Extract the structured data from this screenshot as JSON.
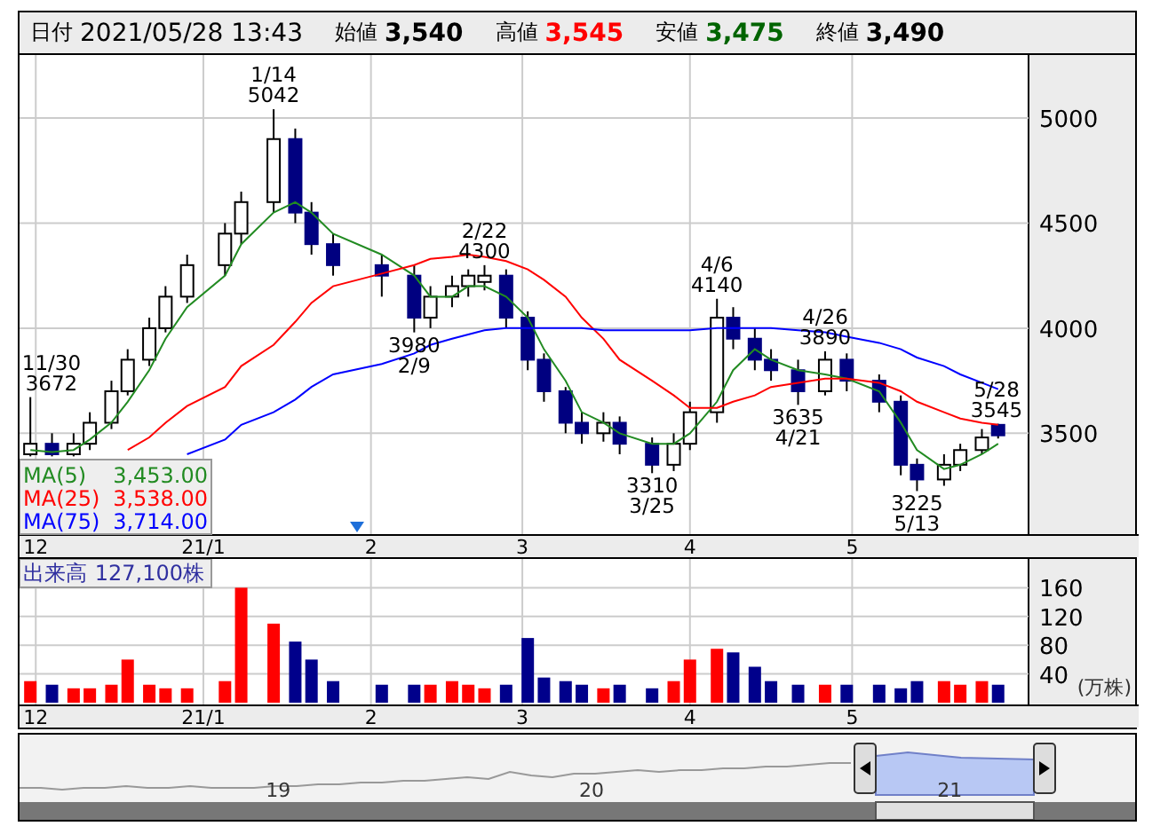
{
  "header": {
    "fields": [
      {
        "label": "日付",
        "value": "2021/05/28 13:43",
        "kind": "date",
        "color": "#000000"
      },
      {
        "label": "始値",
        "value": "3,540",
        "kind": "price",
        "color": "#000000"
      },
      {
        "label": "高値",
        "value": "3,545",
        "kind": "price",
        "color": "#ff0000"
      },
      {
        "label": "安値",
        "value": "3,475",
        "kind": "price",
        "color": "#006400"
      },
      {
        "label": "終値",
        "value": "3,490",
        "kind": "price",
        "color": "#000000"
      }
    ]
  },
  "price_chart": {
    "legend_values": [
      "3,453.00",
      "3,538.00",
      "3,714.00"
    ],
    "chart_data": {
      "type": "candlestick",
      "grid": true,
      "xlim": [
        "2020-11-28",
        "2021-06-23"
      ],
      "ylim": [
        3020,
        5300
      ],
      "yticks": [
        3500,
        4000,
        4500,
        5000
      ],
      "xticks": [
        {
          "value": "2020-12-01",
          "label": "12"
        },
        {
          "value": "2021-01-01",
          "label": "21/1"
        },
        {
          "value": "2021-02-01",
          "label": "2"
        },
        {
          "value": "2021-03-01",
          "label": "3"
        },
        {
          "value": "2021-04-01",
          "label": "4"
        },
        {
          "value": "2021-05-01",
          "label": "5"
        }
      ],
      "x": [
        "2020-11-30",
        "2020-12-04",
        "2020-12-08",
        "2020-12-11",
        "2020-12-15",
        "2020-12-18",
        "2020-12-22",
        "2020-12-25",
        "2020-12-29",
        "2021-01-05",
        "2021-01-08",
        "2021-01-14",
        "2021-01-18",
        "2021-01-21",
        "2021-01-25",
        "2021-02-03",
        "2021-02-09",
        "2021-02-12",
        "2021-02-16",
        "2021-02-19",
        "2021-02-22",
        "2021-02-26",
        "2021-03-02",
        "2021-03-05",
        "2021-03-09",
        "2021-03-12",
        "2021-03-16",
        "2021-03-19",
        "2021-03-25",
        "2021-03-29",
        "2021-04-01",
        "2021-04-06",
        "2021-04-09",
        "2021-04-13",
        "2021-04-16",
        "2021-04-21",
        "2021-04-26",
        "2021-04-30",
        "2021-05-06",
        "2021-05-10",
        "2021-05-13",
        "2021-05-18",
        "2021-05-21",
        "2021-05-25",
        "2021-05-28"
      ],
      "ohlc": [
        [
          3400,
          3672,
          3390,
          3450
        ],
        [
          3450,
          3500,
          3390,
          3400
        ],
        [
          3400,
          3500,
          3390,
          3450
        ],
        [
          3450,
          3600,
          3420,
          3550
        ],
        [
          3550,
          3750,
          3520,
          3700
        ],
        [
          3700,
          3900,
          3680,
          3850
        ],
        [
          3850,
          4050,
          3820,
          4000
        ],
        [
          4000,
          4200,
          3980,
          4150
        ],
        [
          4150,
          4350,
          4120,
          4300
        ],
        [
          4300,
          4500,
          4250,
          4450
        ],
        [
          4450,
          4650,
          4400,
          4600
        ],
        [
          4600,
          5042,
          4550,
          4900
        ],
        [
          4900,
          4950,
          4500,
          4550
        ],
        [
          4550,
          4600,
          4350,
          4400
        ],
        [
          4400,
          4450,
          4250,
          4300
        ],
        [
          4300,
          4350,
          4150,
          4250
        ],
        [
          4250,
          4300,
          3980,
          4050
        ],
        [
          4050,
          4200,
          4000,
          4150
        ],
        [
          4150,
          4250,
          4100,
          4200
        ],
        [
          4200,
          4280,
          4150,
          4250
        ],
        [
          4220,
          4300,
          4180,
          4250
        ],
        [
          4250,
          4280,
          4000,
          4050
        ],
        [
          4050,
          4080,
          3800,
          3850
        ],
        [
          3850,
          3880,
          3650,
          3700
        ],
        [
          3700,
          3720,
          3500,
          3550
        ],
        [
          3550,
          3600,
          3450,
          3500
        ],
        [
          3500,
          3600,
          3460,
          3550
        ],
        [
          3550,
          3580,
          3400,
          3450
        ],
        [
          3450,
          3480,
          3310,
          3350
        ],
        [
          3350,
          3500,
          3320,
          3450
        ],
        [
          3450,
          3650,
          3420,
          3600
        ],
        [
          3600,
          4140,
          3550,
          4050
        ],
        [
          4050,
          4100,
          3900,
          3950
        ],
        [
          3950,
          4000,
          3800,
          3850
        ],
        [
          3850,
          3900,
          3750,
          3800
        ],
        [
          3800,
          3850,
          3635,
          3700
        ],
        [
          3700,
          3890,
          3680,
          3850
        ],
        [
          3850,
          3880,
          3700,
          3750
        ],
        [
          3750,
          3780,
          3600,
          3650
        ],
        [
          3650,
          3680,
          3300,
          3350
        ],
        [
          3350,
          3380,
          3225,
          3280
        ],
        [
          3280,
          3400,
          3250,
          3350
        ],
        [
          3350,
          3450,
          3320,
          3420
        ],
        [
          3420,
          3520,
          3400,
          3480
        ],
        [
          3540,
          3545,
          3475,
          3490
        ]
      ],
      "series": [
        {
          "name": "MA(5)",
          "type": "line",
          "color": "#228b22",
          "values": [
            3420,
            3410,
            3420,
            3470,
            3550,
            3650,
            3800,
            3950,
            4100,
            4250,
            4400,
            4550,
            4600,
            4550,
            4450,
            4350,
            4250,
            4150,
            4150,
            4200,
            4200,
            4150,
            4050,
            3900,
            3750,
            3600,
            3550,
            3500,
            3450,
            3450,
            3500,
            3650,
            3800,
            3900,
            3850,
            3800,
            3780,
            3760,
            3700,
            3550,
            3420,
            3330,
            3350,
            3400,
            3450
          ]
        },
        {
          "name": "MA(25)",
          "type": "line",
          "color": "#ff0000",
          "values": [
            null,
            null,
            null,
            null,
            null,
            3420,
            3480,
            3550,
            3630,
            3720,
            3820,
            3920,
            4030,
            4120,
            4200,
            4260,
            4300,
            4330,
            4340,
            4350,
            4340,
            4320,
            4280,
            4230,
            4150,
            4050,
            3950,
            3850,
            3750,
            3680,
            3620,
            3620,
            3650,
            3680,
            3720,
            3740,
            3760,
            3760,
            3740,
            3700,
            3650,
            3600,
            3570,
            3550,
            3540
          ]
        },
        {
          "name": "MA(75)",
          "type": "line",
          "color": "#0000ff",
          "values": [
            null,
            null,
            null,
            null,
            null,
            null,
            null,
            null,
            3400,
            3470,
            3540,
            3600,
            3660,
            3720,
            3780,
            3830,
            3880,
            3920,
            3950,
            3970,
            3990,
            4000,
            4000,
            4000,
            4000,
            4000,
            3990,
            3990,
            3990,
            3990,
            3990,
            4000,
            4000,
            4000,
            4000,
            3990,
            3980,
            3960,
            3930,
            3900,
            3860,
            3820,
            3780,
            3740,
            3710
          ]
        }
      ],
      "annotations": [
        {
          "x": "2020-11-30",
          "y": 3672,
          "text": "11/30\n3672"
        },
        {
          "x": "2021-01-14",
          "y": 5042,
          "text": "1/14\n5042"
        },
        {
          "x": "2021-02-09",
          "y": 3980,
          "text": "3980\n2/9"
        },
        {
          "x": "2021-02-22",
          "y": 4300,
          "text": "2/22\n4300"
        },
        {
          "x": "2021-03-25",
          "y": 3310,
          "text": "3310\n3/25"
        },
        {
          "x": "2021-04-06",
          "y": 4140,
          "text": "4/6\n4140"
        },
        {
          "x": "2021-04-21",
          "y": 3635,
          "text": "3635\n4/21"
        },
        {
          "x": "2021-04-26",
          "y": 3890,
          "text": "4/26\n3890"
        },
        {
          "x": "2021-05-13",
          "y": 3225,
          "text": "3225\n5/13"
        },
        {
          "x": "2021-05-28",
          "y": 3545,
          "text": "5/28\n3545"
        }
      ]
    }
  },
  "volume_chart": {
    "value": "127,100株",
    "unit": "(万株)",
    "chart_data": {
      "type": "bar",
      "grid": true,
      "xlim": [
        "2020-11-28",
        "2021-06-23"
      ],
      "ylim": [
        0,
        200
      ],
      "yticks": [
        40,
        80,
        120,
        160
      ],
      "xticks": [
        {
          "value": "2020-12-01",
          "label": "12"
        },
        {
          "value": "2021-01-01",
          "label": "21/1"
        },
        {
          "value": "2021-02-01",
          "label": "2"
        },
        {
          "value": "2021-03-01",
          "label": "3"
        },
        {
          "value": "2021-04-01",
          "label": "4"
        },
        {
          "value": "2021-05-01",
          "label": "5"
        }
      ],
      "x": [
        "2020-11-30",
        "2020-12-04",
        "2020-12-08",
        "2020-12-11",
        "2020-12-15",
        "2020-12-18",
        "2020-12-22",
        "2020-12-25",
        "2020-12-29",
        "2021-01-05",
        "2021-01-08",
        "2021-01-14",
        "2021-01-18",
        "2021-01-21",
        "2021-01-25",
        "2021-02-03",
        "2021-02-09",
        "2021-02-12",
        "2021-02-16",
        "2021-02-19",
        "2021-02-22",
        "2021-02-26",
        "2021-03-02",
        "2021-03-05",
        "2021-03-09",
        "2021-03-12",
        "2021-03-16",
        "2021-03-19",
        "2021-03-25",
        "2021-03-29",
        "2021-04-01",
        "2021-04-06",
        "2021-04-09",
        "2021-04-13",
        "2021-04-16",
        "2021-04-21",
        "2021-04-26",
        "2021-04-30",
        "2021-05-06",
        "2021-05-10",
        "2021-05-13",
        "2021-05-18",
        "2021-05-21",
        "2021-05-25",
        "2021-05-28"
      ],
      "series": [
        {
          "name": "出来高",
          "color": "#ff0000",
          "values": [
            30,
            null,
            20,
            20,
            25,
            60,
            25,
            20,
            20,
            30,
            160,
            110,
            null,
            null,
            null,
            null,
            null,
            25,
            30,
            25,
            20,
            null,
            null,
            null,
            null,
            null,
            20,
            null,
            null,
            30,
            60,
            75,
            null,
            null,
            null,
            null,
            25,
            null,
            null,
            null,
            null,
            30,
            25,
            30,
            null
          ]
        },
        {
          "color": "#00008b",
          "values": [
            null,
            25,
            null,
            null,
            null,
            null,
            null,
            null,
            null,
            null,
            null,
            null,
            85,
            60,
            30,
            25,
            25,
            null,
            null,
            null,
            null,
            25,
            90,
            35,
            30,
            25,
            null,
            25,
            20,
            null,
            null,
            null,
            70,
            50,
            30,
            25,
            null,
            25,
            25,
            20,
            30,
            null,
            null,
            null,
            25
          ]
        }
      ]
    }
  },
  "navigator": {
    "labels": [
      "19",
      "20",
      "21"
    ]
  }
}
